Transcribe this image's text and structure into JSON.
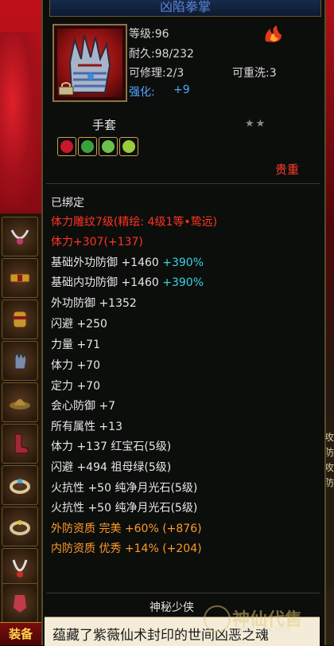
{
  "item": {
    "title": "凶陷拳掌",
    "level": "等级:96",
    "durability": "耐久:98/232",
    "repairable": "可修理:2/3",
    "rewashable": "可重洗:3",
    "enhance_label": "强化:",
    "enhance_value": "+9",
    "type": "手套",
    "stars": "★★",
    "quality": "贵重"
  },
  "properties": [
    {
      "text": "已绑定",
      "extra": ""
    },
    {
      "text": "体力雕纹7级(精绘: 4级1等•鸷远)",
      "extra": ""
    },
    {
      "text": "体力+307(+137)",
      "extra": ""
    },
    {
      "text": "基础外功防御 +1460 ",
      "extra": "+390%"
    },
    {
      "text": "基础内功防御 +1460 ",
      "extra": "+390%"
    },
    {
      "text": "外功防御 +1352",
      "extra": ""
    },
    {
      "text": "闪避 +250",
      "extra": ""
    },
    {
      "text": "力量 +71",
      "extra": ""
    },
    {
      "text": "体力 +70",
      "extra": ""
    },
    {
      "text": "定力 +70",
      "extra": ""
    },
    {
      "text": "会心防御 +7",
      "extra": ""
    },
    {
      "text": "所有属性 +13",
      "extra": ""
    },
    {
      "text": "体力 +137 红宝石(5级)",
      "extra": ""
    },
    {
      "text": "闪避 +494 祖母绿(5级)",
      "extra": ""
    },
    {
      "text": "火抗性 +50 纯净月光石(5级)",
      "extra": ""
    },
    {
      "text": "火抗性 +50 纯净月光石(5级)",
      "extra": ""
    },
    {
      "text": "外防资质  完美 +60% (+876)",
      "extra": ""
    },
    {
      "text": "内防资质  优秀 +14% (+204)",
      "extra": ""
    }
  ],
  "footer": {
    "name": "神秘少侠",
    "description": "蕴藏了紫薇仙术封印的世间凶恶之魂"
  },
  "side_panel": [
    "攻",
    "防",
    "攻",
    "防"
  ],
  "bottom_button": "装备",
  "watermark": {
    "text": "神仙代售",
    "url": "www.sxds.com"
  },
  "colors": {
    "gem_red": "#c8182a",
    "gem_green": "#3aa23a",
    "gem_green_light": "#6ac24a",
    "gem_yellowgreen": "#9acc3a"
  }
}
